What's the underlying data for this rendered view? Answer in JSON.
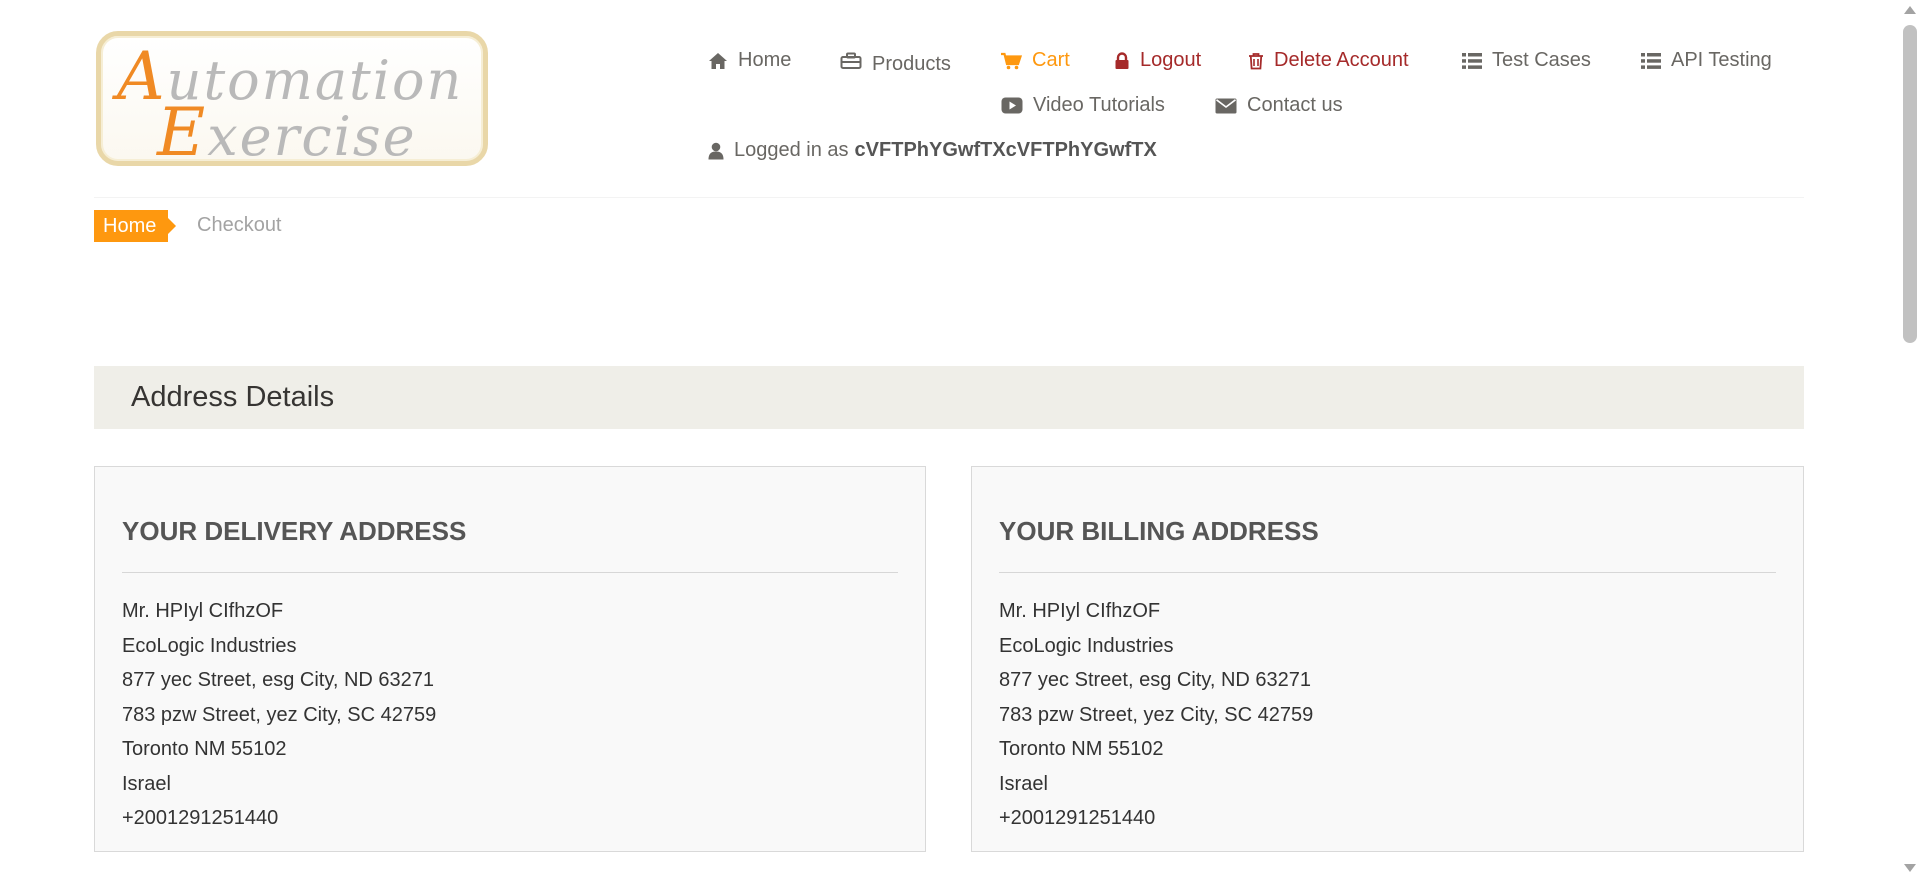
{
  "logo": {
    "line1_cap": "A",
    "line1_rest": "utomation",
    "line2_cap": "E",
    "line2_rest": "xercise"
  },
  "nav": {
    "home": {
      "label": "Home",
      "icon": "home-icon"
    },
    "products": {
      "label": "Products",
      "icon": "products-icon"
    },
    "cart": {
      "label": "Cart",
      "icon": "shopping-cart-icon"
    },
    "logout": {
      "label": "Logout",
      "icon": "lock-icon"
    },
    "delete_account": {
      "label": "Delete Account",
      "icon": "trash-icon"
    },
    "test_cases": {
      "label": "Test Cases",
      "icon": "list-icon"
    },
    "api_testing": {
      "label": "API Testing",
      "icon": "list-icon"
    },
    "video_tutorials": {
      "label": "Video Tutorials",
      "icon": "youtube-play-icon"
    },
    "contact_us": {
      "label": "Contact us",
      "icon": "envelope-icon"
    }
  },
  "user": {
    "prefix": "Logged in as",
    "username": "cVFTPhYGwfTXcVFTPhYGwfTX",
    "icon": "user-icon"
  },
  "breadcrumb": {
    "home": "Home",
    "current": "Checkout"
  },
  "section": {
    "title": "Address Details"
  },
  "delivery": {
    "title": "YOUR DELIVERY ADDRESS",
    "lines": [
      "Mr. HPIyl CIfhzOF",
      "EcoLogic Industries",
      "877 yec Street, esg City, ND 63271",
      "783 pzw Street, yez City, SC 42759",
      "Toronto NM 55102",
      "Israel",
      "+2001291251440"
    ]
  },
  "billing": {
    "title": "YOUR BILLING ADDRESS",
    "lines": [
      "Mr. HPIyl CIfhzOF",
      "EcoLogic Industries",
      "877 yec Street, esg City, ND 63271",
      "783 pzw Street, yez City, SC 42759",
      "Toronto NM 55102",
      "Israel",
      "+2001291251440"
    ]
  },
  "colors": {
    "accent": "#fe980f",
    "danger": "#a52a2a",
    "text": "#696763",
    "section_bg": "#efeee8"
  }
}
